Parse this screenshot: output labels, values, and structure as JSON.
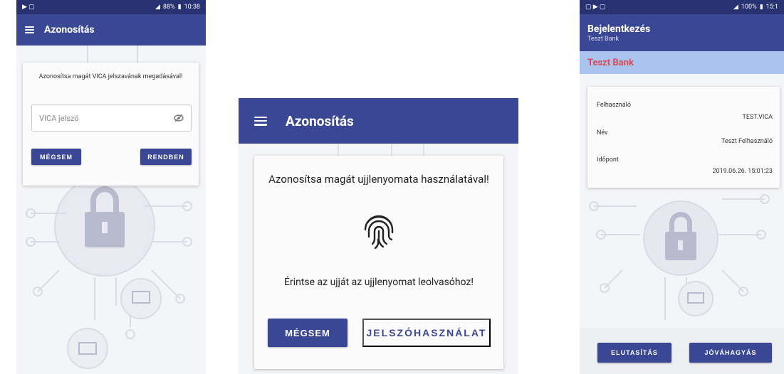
{
  "screen1": {
    "status_time": "10:38",
    "status_battery": "88%",
    "app_title": "Azonosítás",
    "prompt": "Azonosítsa magát VICA jelszavának megadásával!",
    "input_placeholder": "VICA jelszó",
    "cancel_label": "MÉGSEM",
    "ok_label": "RENDBEN"
  },
  "screen2": {
    "app_title": "Azonosítás",
    "prompt": "Azonosítsa magát ujjlenyomata használatával!",
    "hint": "Érintse az ujját az ujjlenyomat leolvasóhoz!",
    "cancel_label": "MÉGSEM",
    "password_label": "JELSZÓHASZNÁLAT"
  },
  "screen3": {
    "status_time": "15:1",
    "status_battery": "100%",
    "app_title": "Bejelentkezés",
    "app_subtitle": "Teszt Bank",
    "bank_name": "Teszt Bank",
    "fields": [
      {
        "label": "Felhasználó",
        "value": "TEST.VICA"
      },
      {
        "label": "Név",
        "value": "Teszt Felhasználó"
      },
      {
        "label": "Időpont",
        "value": "2019.06.26. 15:01:23"
      }
    ],
    "reject_label": "ELUTASÍTÁS",
    "approve_label": "JÓVÁHAGYÁS"
  },
  "colors": {
    "appbar": "#3a4795",
    "statusbar": "#283272",
    "bank_bar": "#a9c4ef",
    "bank_name": "#d94a52"
  },
  "icons": {
    "menu": "menu-icon",
    "visibility_off": "eye-off-icon",
    "fingerprint": "fingerprint-icon"
  }
}
